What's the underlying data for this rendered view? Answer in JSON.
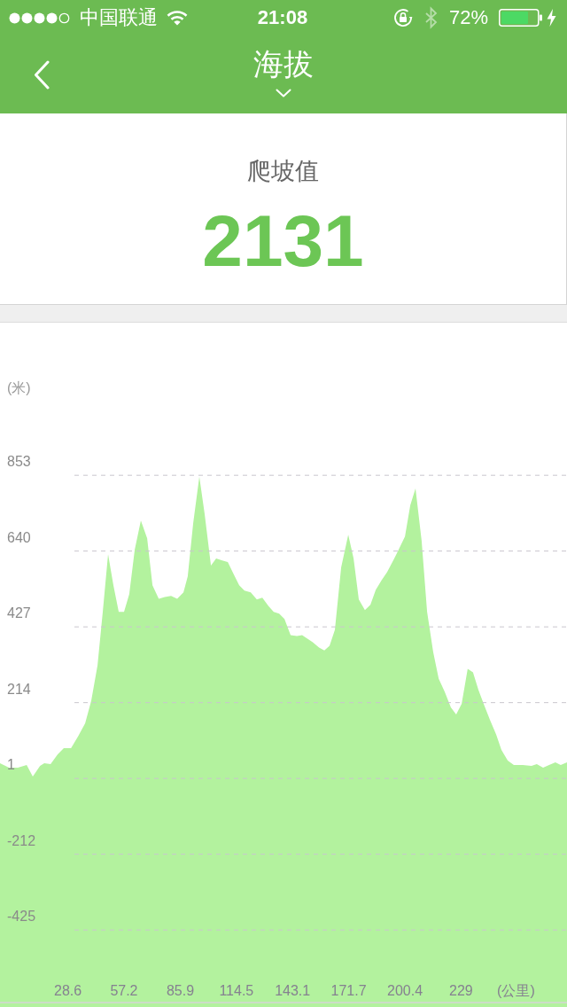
{
  "status_bar": {
    "carrier": "中国联通",
    "time": "21:08",
    "battery": "72%"
  },
  "nav_bar": {
    "title": "海拔"
  },
  "summary": {
    "label": "爬坡值",
    "value": "2131"
  },
  "chart": {
    "chart_data": {
      "type": "area",
      "grid": true,
      "xlabel": "(公里)",
      "ylabel": "(米)",
      "xlim": [
        -6.0,
        283.0
      ],
      "ylim": [
        -629,
        1282
      ],
      "xticks": [
        28.6,
        57.2,
        85.9,
        114.5,
        143.1,
        171.7,
        200.4,
        229
      ],
      "yticks": [
        853,
        640,
        427,
        214,
        1,
        -212,
        -425
      ],
      "x": [
        -6.0,
        -1.4,
        3.1,
        7.6,
        10.7,
        14.4,
        16.6,
        19.8,
        23.4,
        26.5,
        30.2,
        33.8,
        37.4,
        40.5,
        43.7,
        46.4,
        49.1,
        51.8,
        54.5,
        57.2,
        59.9,
        62.7,
        65.8,
        69.0,
        71.7,
        74.9,
        78.0,
        81.2,
        84.3,
        87.5,
        89.7,
        92.5,
        95.6,
        98.3,
        101.5,
        104.2,
        106.9,
        110.1,
        113.2,
        115.9,
        118.6,
        121.8,
        124.9,
        127.7,
        130.8,
        133.5,
        136.3,
        139.0,
        142.1,
        145.3,
        148.0,
        150.7,
        153.4,
        156.6,
        159.3,
        162.0,
        164.7,
        167.9,
        171.5,
        174.2,
        176.9,
        180.0,
        182.8,
        185.5,
        188.6,
        191.3,
        194.5,
        197.2,
        200.4,
        203.1,
        205.8,
        208.9,
        211.7,
        214.8,
        217.6,
        220.7,
        223.8,
        226.5,
        229.3,
        232.4,
        235.1,
        237.9,
        241.0,
        243.7,
        246.9,
        249.6,
        252.8,
        255.9,
        260.4,
        264.9,
        267.6,
        270.8,
        273.9,
        277.1,
        279.8,
        283.0
      ],
      "values": [
        44,
        31,
        31,
        39,
        6,
        36,
        44,
        41,
        69,
        86,
        86,
        119,
        156,
        219,
        319,
        469,
        631,
        544,
        469,
        469,
        519,
        644,
        726,
        676,
        544,
        506,
        511,
        514,
        506,
        524,
        569,
        719,
        849,
        744,
        599,
        619,
        614,
        609,
        574,
        544,
        529,
        524,
        504,
        509,
        486,
        469,
        464,
        449,
        404,
        401,
        404,
        394,
        384,
        369,
        361,
        374,
        419,
        594,
        686,
        619,
        504,
        474,
        489,
        531,
        559,
        581,
        614,
        644,
        681,
        769,
        816,
        669,
        469,
        356,
        281,
        244,
        201,
        181,
        211,
        309,
        299,
        249,
        204,
        166,
        124,
        81,
        51,
        39,
        39,
        36,
        41,
        31,
        39,
        46,
        39,
        46
      ]
    }
  }
}
